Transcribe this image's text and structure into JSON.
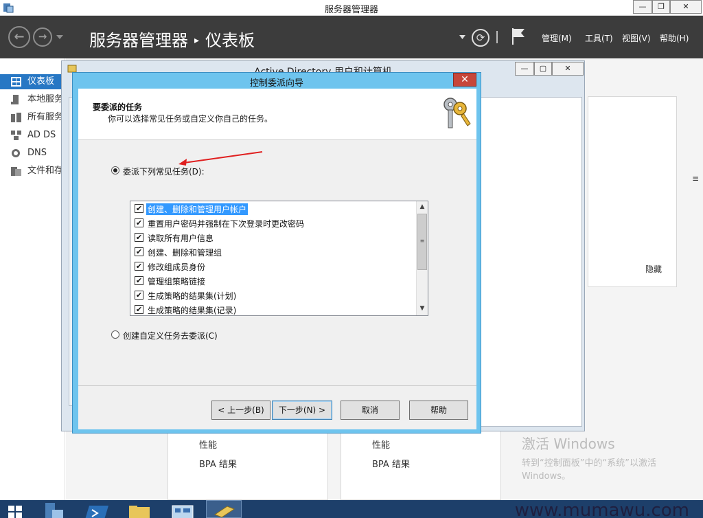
{
  "main_window": {
    "title": "服务器管理器",
    "minimize": "—",
    "restore": "❐",
    "close": "✕"
  },
  "header": {
    "back_icon": "←",
    "forward_icon": "→",
    "crumb_app": "服务器管理器",
    "crumb_sep": "▸",
    "crumb_page": "仪表板",
    "refresh_icon": "⟳",
    "menus": [
      "管理(M)",
      "工具(T)",
      "视图(V)",
      "帮助(H)"
    ]
  },
  "sidebar": {
    "items": [
      {
        "label": "仪表板",
        "icon": "dashboard-icon"
      },
      {
        "label": "本地服务器",
        "icon": "server-icon"
      },
      {
        "label": "所有服务器",
        "icon": "servers-icon"
      },
      {
        "label": "AD DS",
        "icon": "adds-icon"
      },
      {
        "label": "DNS",
        "icon": "dns-icon"
      },
      {
        "label": "文件和存储服务",
        "icon": "file-icon"
      }
    ]
  },
  "dashboard": {
    "hide_label": "隐藏",
    "tile1": {
      "perf": "性能",
      "bpa": "BPA 结果"
    },
    "tile2": {
      "perf": "性能",
      "bpa": "BPA 结果"
    },
    "activation": {
      "line1": "激活 Windows",
      "line2": "转到“控制面板”中的“系统”以激活",
      "line3": "Windows。"
    }
  },
  "ad_window": {
    "title": "Active Directory 用户和计算机"
  },
  "wizard": {
    "title": "控制委派向导",
    "close": "✕",
    "heading": "要委派的任务",
    "subheading": "你可以选择常见任务或自定义你自己的任务。",
    "option_common": "委派下列常见任务(D):",
    "option_custom": "创建自定义任务去委派(C)",
    "tasks": [
      {
        "label": "创建、删除和管理用户帐户",
        "checked": true
      },
      {
        "label": "重置用户密码并强制在下次登录时更改密码",
        "checked": true
      },
      {
        "label": "读取所有用户信息",
        "checked": true
      },
      {
        "label": "创建、删除和管理组",
        "checked": true
      },
      {
        "label": "修改组成员身份",
        "checked": true
      },
      {
        "label": "管理组策略链接",
        "checked": true
      },
      {
        "label": "生成策略的结果集(计划)",
        "checked": true
      },
      {
        "label": "生成策略的结果集(记录)",
        "checked": true
      }
    ],
    "check_mark": "✔",
    "scroll_up": "▲",
    "scroll_down": "▼",
    "scroll_grip": "≡",
    "buttons": {
      "back": "< 上一步(B)",
      "next": "下一步(N) >",
      "cancel": "取消",
      "help": "帮助"
    }
  },
  "taskbar": {
    "watermark_site": "www.mumawu.com"
  },
  "colors": {
    "header_bg": "#3c3c3c",
    "active_sidebar": "#2777c4",
    "wizard_frame": "#6ec4ee",
    "close_red": "#c7463a",
    "annotation_arrow": "#e02020"
  }
}
